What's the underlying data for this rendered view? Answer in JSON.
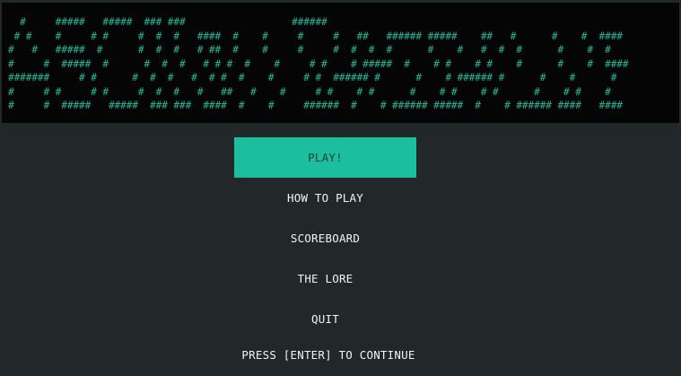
{
  "banner": {
    "art": "  #     #####   #####  ### ###                  ######\n # #    #     # #     #  #  #   ####  #    #     #     #   ##   ###### #####    ##   #      #    #  ####\n#   #   #####  #      #  #  #   # ##  #    #     #     #  #  #  #      #    #   #  #  #      #    #  #\n#     #  #####  #      #  #  #   # # #  #    #     # #    # #####  #    # #    # #    #      #    #  ####\n#######     # #      #  #  #   #  # #  #    #     # #  ###### #      #    # ###### #      #    #      #\n#     # #     # #     #  #  #   #   ##   #    #     # #    # #      #    # #    # #      #    # #    #\n#     #  #####   #####  ### ###  ####  #    #     ######  #    # ###### #####  #    # ###### ####   ####"
  },
  "menu": {
    "items": [
      {
        "label": "PLAY!"
      },
      {
        "label": "HOW TO PLAY"
      },
      {
        "label": "SCOREBOARD"
      },
      {
        "label": "THE LORE"
      },
      {
        "label": "QUIT"
      }
    ],
    "selected_index": 0
  },
  "prompt": "PRESS [ENTER] TO CONTINUE",
  "colors": {
    "background": "#222829",
    "banner_background": "#050505",
    "accent": "#1bbf9f",
    "banner_text": "#2bb597",
    "text": "#f2f2f2"
  }
}
